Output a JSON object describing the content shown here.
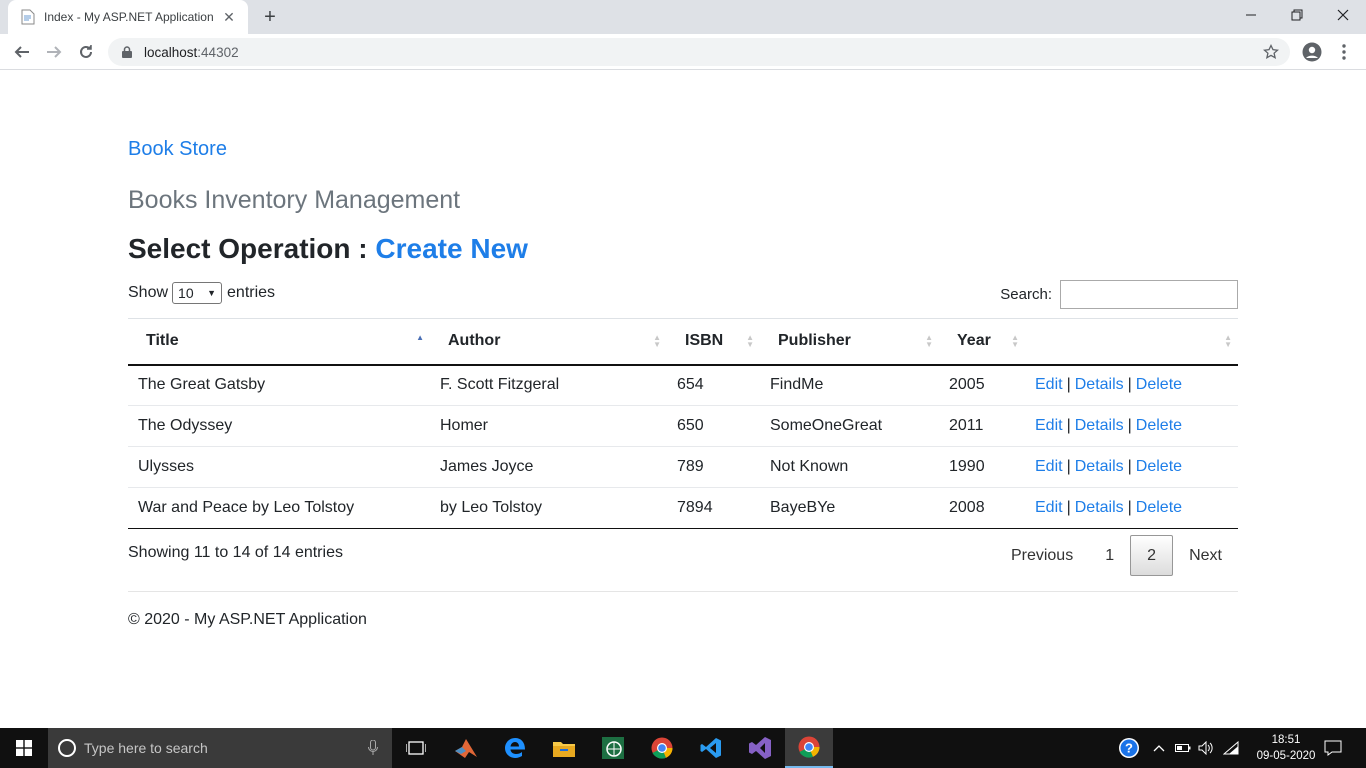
{
  "browser": {
    "tab_title": "Index - My ASP.NET Application",
    "url_host": "localhost",
    "url_port": ":44302"
  },
  "page": {
    "brand": "Book Store",
    "subtitle": "Books Inventory Management",
    "operation_label": "Select Operation : ",
    "create_link": "Create New",
    "length": {
      "show": "Show",
      "value": "10",
      "entries": "entries"
    },
    "search_label": "Search:",
    "search_value": "",
    "columns": [
      "Title",
      "Author",
      "ISBN",
      "Publisher",
      "Year",
      ""
    ],
    "rows": [
      {
        "title": "The Great Gatsby",
        "author": "F. Scott Fitzgeral",
        "isbn": "654",
        "publisher": "FindMe",
        "year": "2005"
      },
      {
        "title": "The Odyssey",
        "author": "Homer",
        "isbn": "650",
        "publisher": "SomeOneGreat",
        "year": "2011"
      },
      {
        "title": "Ulysses",
        "author": "James Joyce",
        "isbn": "789",
        "publisher": "Not Known",
        "year": "1990"
      },
      {
        "title": "War and Peace by Leo Tolstoy",
        "author": "by Leo Tolstoy",
        "isbn": "7894",
        "publisher": "BayeBYe",
        "year": "2008"
      }
    ],
    "actions": {
      "edit": "Edit",
      "details": "Details",
      "delete": "Delete",
      "sep": "|"
    },
    "info": "Showing 11 to 14 of 14 entries",
    "pagination": {
      "previous": "Previous",
      "page1": "1",
      "page2": "2",
      "next": "Next"
    },
    "footer": "© 2020 - My ASP.NET Application"
  },
  "taskbar": {
    "search_placeholder": "Type here to search",
    "time": "18:51",
    "date": "09-05-2020"
  },
  "colors": {
    "link": "#1e7ee8",
    "muted": "#6c757d",
    "taskbar": "#101010"
  }
}
